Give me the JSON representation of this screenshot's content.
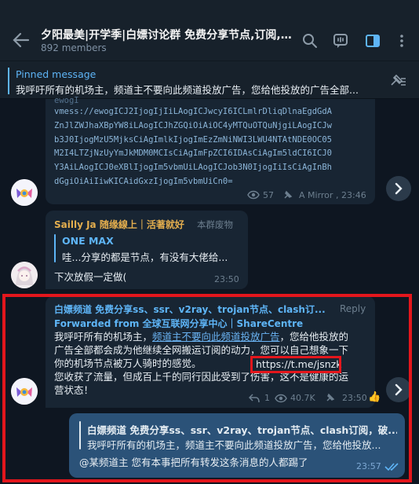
{
  "header": {
    "title": "夕阳最美|开学季|白嫖讨论群 免费分享节点,订阅,破解...",
    "members": "892 members"
  },
  "pinned": {
    "label": "Pinned message",
    "text": "我呼吁所有的机场主，频道主不要向此频道投放广告，您给他投放的广告全部..."
  },
  "msg1": {
    "lines": [
      "vmess://ewogICJ2IjogIjIiLAogICJwcyI6ICLmlrDliqDlnaEgdGdA",
      "ZnJlZWJhaXBpYW8iLAogICJhZGQiOiAiOC4yMTQuOTQuNjgiLAogICJw",
      "b3J0IjogMzU5MjksCiAgImlkIjogImEzZmNiNWI3LWU4NTAtNDE0OC05",
      "M2I4LTZjNzUyYmJkMDM0MCIsCiAgImFpZCI6IDAsCiAgIm5ldCI6ICJ0",
      "Y3AiLAogICJ0eXBlIjogIm5vbmUiLAogICJob3N0IjogIiIsCiAgInBh",
      "dGgiOiAiIiwKICAidGxzIjogIm5vbmUiCn0="
    ],
    "views": "57",
    "author": "A Mirror",
    "time": "23:46"
  },
  "msg2": {
    "sender": "Sailly Ja 随缘線上｜活著就好",
    "title": "本群废物",
    "reply_name": "ONE MAX",
    "reply_text": "哇...分享的都是节点，有没有大佬给...",
    "text": "下次放假一定做(",
    "time": "23:50"
  },
  "msg3": {
    "sender": "白嫖频道 免费分享ss、ssr、v2ray、trojan节点、clash订...",
    "reply_label": "Reply",
    "forwarded": "Forwarded from 全球互联网分享中心｜ShareCentre",
    "line1a": "我呼吁所有的机场主，",
    "line1link": "频道主不要向此频道投放广告",
    "line1b": "，您给他投放的",
    "line2": "广告全部都会成为他继续全网搬运订阅的动力，您可以自己想象一下",
    "line3": "你的机场节点被万人骑时的感觉。",
    "url": "https://t.me/jsnzk",
    "line4": "您收获了流量，但成百上千的同行因此受到了伤害，这不是健康的运",
    "line5": "营状态！",
    "replies": "1",
    "views": "40.7K",
    "time": "23:50"
  },
  "msg4": {
    "reply_name": "白嫖频道 免费分享ss、ssr、v2ray、trojan节点、clash订阅，破...",
    "reply_text": "我呼吁所有的机场主，频道主不要向此频道投放广告，您给他投放...",
    "text": "@某频道主 您有本事把所有转发这条消息的人都踢了",
    "time": "23:57"
  },
  "colors": {
    "accent": "#5eb5f7",
    "sender_orange": "#e4ae4e",
    "highlight_red": "#e3161c",
    "own_bubble": "#2b5278"
  },
  "icons": [
    "back-arrow-icon",
    "search-icon",
    "video-chat-icon",
    "sidebar-toggle-icon",
    "more-vert-icon",
    "unpin-icon",
    "eye-icon",
    "pin-icon",
    "reply-arrow-icon",
    "chevron-right-icon",
    "double-check-icon",
    "thumbs-up-icon"
  ]
}
